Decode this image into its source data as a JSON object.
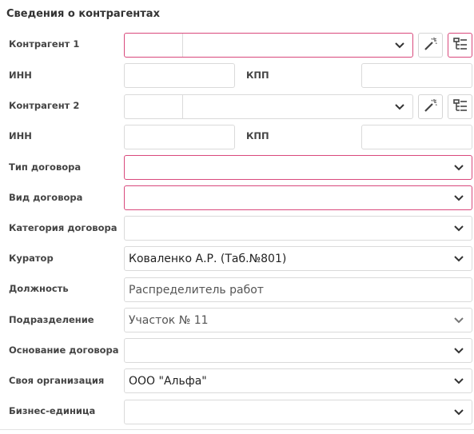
{
  "section": {
    "title": "Сведения о контрагентах"
  },
  "counterparty1": {
    "label": "Контрагент 1",
    "value": ""
  },
  "inn1": {
    "label": "ИНН",
    "value": ""
  },
  "kpp1": {
    "label": "КПП",
    "value": ""
  },
  "counterparty2": {
    "label": "Контрагент 2",
    "value": ""
  },
  "inn2": {
    "label": "ИНН",
    "value": ""
  },
  "kpp2": {
    "label": "КПП",
    "value": ""
  },
  "contract_type": {
    "label": "Тип договора",
    "value": ""
  },
  "contract_kind": {
    "label": "Вид договора",
    "value": ""
  },
  "contract_category": {
    "label": "Категория договора",
    "value": ""
  },
  "curator": {
    "label": "Куратор",
    "value": "Коваленко А.Р. (Таб.№801)"
  },
  "position": {
    "label": "Должность",
    "value": "Распределитель работ"
  },
  "department": {
    "label": "Подразделение",
    "value": "Участок № 11"
  },
  "contract_basis": {
    "label": "Основание договора",
    "value": ""
  },
  "own_organization": {
    "label": "Своя организация",
    "value": "ООО \"Альфа\""
  },
  "business_unit": {
    "label": "Бизнес-единица",
    "value": ""
  },
  "icons": {
    "autofill": "magic-wand-icon",
    "tree": "tree-list-icon",
    "dropdown": "chevron-down-icon"
  },
  "colors": {
    "required_border": "#d9497c",
    "border": "#dadada",
    "label": "#444444"
  }
}
